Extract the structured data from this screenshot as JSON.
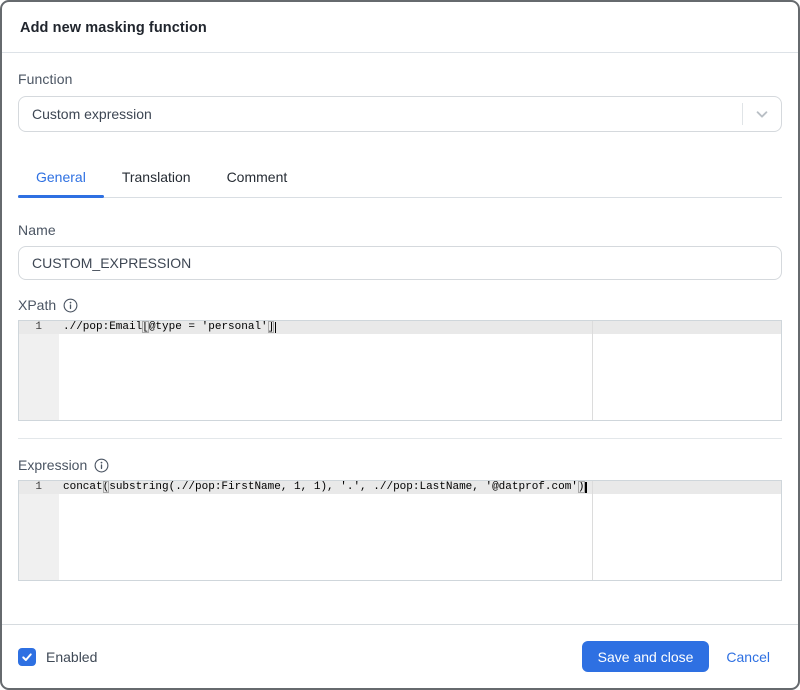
{
  "dialog": {
    "title": "Add new masking function"
  },
  "function_field": {
    "label": "Function",
    "value": "Custom expression"
  },
  "tabs": [
    {
      "label": "General",
      "active": true
    },
    {
      "label": "Translation",
      "active": false
    },
    {
      "label": "Comment",
      "active": false
    }
  ],
  "name_field": {
    "label": "Name",
    "value": "CUSTOM_EXPRESSION"
  },
  "xpath_field": {
    "label": "XPath",
    "line_number": "1",
    "code": ".//pop:Email[@type = 'personal']",
    "segments": [
      {
        "text": ".//pop:Email",
        "match": false
      },
      {
        "text": "[",
        "match": true
      },
      {
        "text": "@type = 'personal'",
        "match": false
      },
      {
        "text": "]",
        "match": true
      }
    ]
  },
  "expression_field": {
    "label": "Expression",
    "line_number": "1",
    "code": "concat(substring(.//pop:FirstName, 1, 1), '.', .//pop:LastName, '@datprof.com')",
    "segments": [
      {
        "text": "concat",
        "match": false
      },
      {
        "text": "(",
        "match": true
      },
      {
        "text": "substring(.//pop:FirstName, 1, 1), '.', .//pop:LastName, '@datprof.com'",
        "match": false
      },
      {
        "text": ")",
        "match": true
      }
    ]
  },
  "footer": {
    "enabled_label": "Enabled",
    "enabled_checked": true,
    "save_label": "Save and close",
    "cancel_label": "Cancel"
  },
  "colors": {
    "accent": "#2e70e2",
    "active_line": "#e9e9e9",
    "gutter": "#f0f0f0",
    "border": "#d5d9dd"
  }
}
